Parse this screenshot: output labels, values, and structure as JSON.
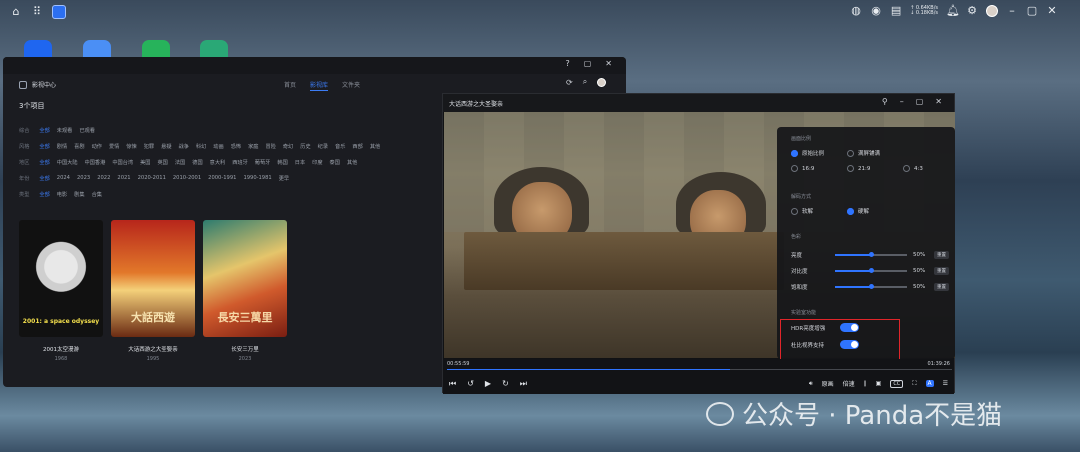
{
  "topbar": {
    "net_up": "↑ 0.64KB/s",
    "net_down": "↓ 0.18KB/s"
  },
  "colors": {
    "accent": "#2f74ff",
    "highlight_box": "#e0252a"
  },
  "media_center": {
    "title": "影视中心",
    "tabs": [
      "首页",
      "影视库",
      "文件夹"
    ],
    "active_tab": 1,
    "count": "3个项目",
    "filters": [
      {
        "label": "综合",
        "options": [
          "全部",
          "未观看",
          "已观看"
        ],
        "selected": 0
      },
      {
        "label": "风格",
        "options": [
          "全部",
          "剧情",
          "喜剧",
          "动作",
          "爱情",
          "惊悚",
          "犯罪",
          "悬疑",
          "战争",
          "科幻",
          "动画",
          "恐怖",
          "家庭",
          "冒险",
          "奇幻",
          "历史",
          "纪录",
          "音乐",
          "西部",
          "其他"
        ],
        "selected": 0
      },
      {
        "label": "地区",
        "options": [
          "全部",
          "中国大陆",
          "中国香港",
          "中国台湾",
          "美国",
          "英国",
          "法国",
          "德国",
          "意大利",
          "西班牙",
          "葡萄牙",
          "韩国",
          "日本",
          "印度",
          "泰国",
          "其他"
        ],
        "selected": 0
      },
      {
        "label": "年份",
        "options": [
          "全部",
          "2024",
          "2023",
          "2022",
          "2021",
          "2020-2011",
          "2010-2001",
          "2000-1991",
          "1990-1981",
          "更早"
        ],
        "selected": 0
      },
      {
        "label": "类型",
        "options": [
          "全部",
          "电影",
          "剧集",
          "合集"
        ],
        "selected": 0
      }
    ],
    "movies": [
      {
        "title": "2001太空漫游",
        "year": "1968",
        "poster_text": "2001: a space odyssey"
      },
      {
        "title": "大话西游之大圣娶亲",
        "year": "1995",
        "poster_text": "大話西遊"
      },
      {
        "title": "长安三万里",
        "year": "2023",
        "poster_text": "長安三萬里"
      }
    ]
  },
  "player": {
    "title": "大话西游之大圣娶亲",
    "time_current": "00:55:59",
    "time_total": "01:39:26",
    "progress": 0.56,
    "panel": {
      "aspect_title": "画面比例",
      "aspect_options": [
        "原始比例",
        "满屏铺满",
        "16:9",
        "21:9",
        "4:3"
      ],
      "aspect_selected": 0,
      "decode_title": "解码方式",
      "decode_options": [
        "软解",
        "硬解"
      ],
      "decode_selected": 1,
      "color_title": "色彩",
      "sliders": [
        {
          "label": "亮度",
          "value": "50%",
          "reset": "重置",
          "level": 0.5
        },
        {
          "label": "对比度",
          "value": "50%",
          "reset": "重置",
          "level": 0.5
        },
        {
          "label": "饱和度",
          "value": "50%",
          "reset": "重置",
          "level": 0.5
        }
      ],
      "exp_title": "实验室功能",
      "toggles": [
        {
          "label": "HDR亮度增强",
          "on": true
        },
        {
          "label": "杜比视界支持",
          "on": true
        }
      ]
    },
    "controls": {
      "source": "原画",
      "speed": "倍速"
    }
  },
  "watermark": "公众号 · Panda不是猫"
}
